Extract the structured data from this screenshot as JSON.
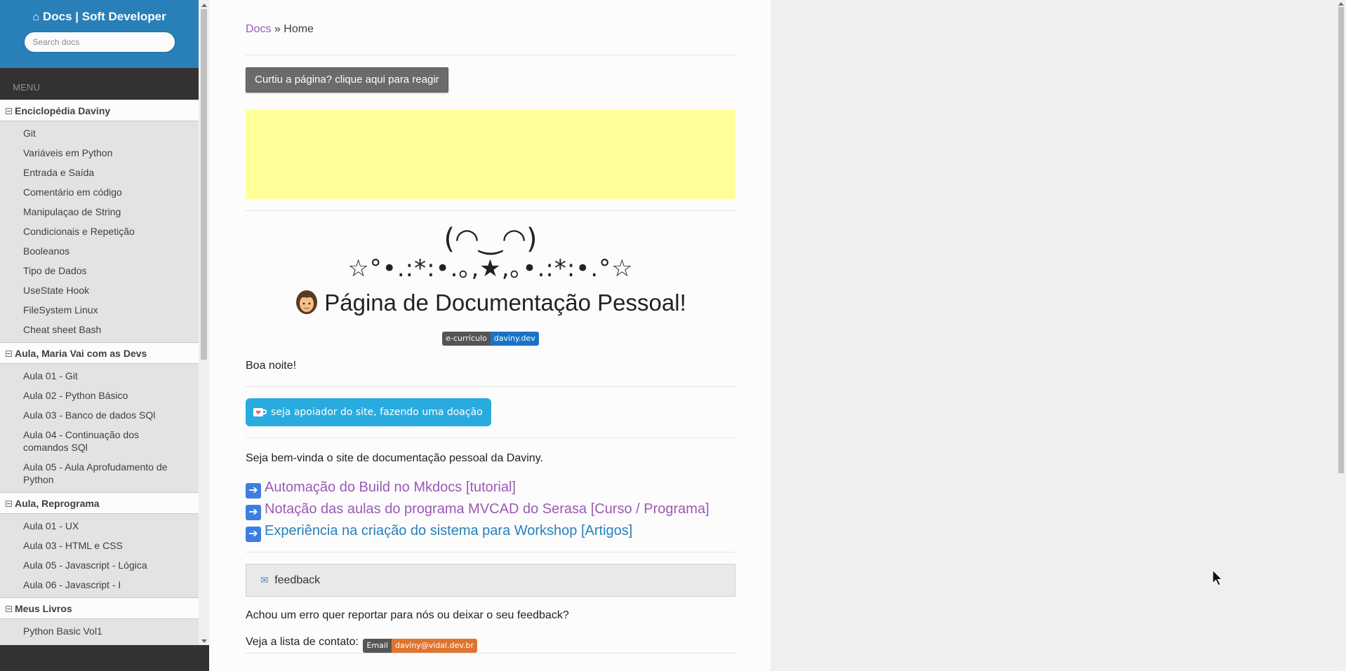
{
  "sidebar": {
    "brand": "Docs | Soft Developer",
    "search_placeholder": "Search docs",
    "menu_caption": "MENU",
    "sections": [
      {
        "title": "Enciclopédia Daviny",
        "items": [
          "Git",
          "Variáveis em Python",
          "Entrada e Saída",
          "Comentário em código",
          "Manipulaçao de String",
          "Condicionais e Repetição",
          "Booleanos",
          "Tipo de Dados",
          "UseState Hook",
          "FileSystem Linux",
          "Cheat sheet Bash"
        ]
      },
      {
        "title": "Aula, Maria Vai com as Devs",
        "items": [
          "Aula 01 - Git",
          "Aula 02 - Python Básico",
          "Aula 03 - Banco de dados SQl",
          "Aula 04 - Continuação dos comandos SQl",
          "Aula 05 - Aula Aprofudamento de Python"
        ]
      },
      {
        "title": "Aula, Reprograma",
        "items": [
          "Aula 01 - UX",
          "Aula 03 - HTML e CSS",
          "Aula 05 - Javascript - Lógica",
          "Aula 06 - Javascript - I"
        ]
      },
      {
        "title": "Meus Livros",
        "items": [
          "Python Basic Vol1"
        ]
      }
    ]
  },
  "breadcrumb": {
    "root": "Docs",
    "separator": "»",
    "current": "Home"
  },
  "react_button": "Curtiu a página? clique aqui para reagir",
  "kaomoji": {
    "line1": "(◠‿◠)",
    "line2": "☆°•.:*:•.｡,★,｡•.:*:•.°☆"
  },
  "page_title": "Página de Documentação Pessoal!",
  "badge_curriculo": {
    "left": "e-currículo",
    "right": "daviny.dev"
  },
  "greeting": "Boa noite!",
  "donate_button": "seja apoiador do site, fazendo uma doação",
  "welcome_text": "Seja bem-vinda o site de documentação pessoal da Daviny.",
  "links": [
    {
      "text": "Automação do Build no Mkdocs [tutorial]",
      "color": "#9b59b6"
    },
    {
      "text": "Notação das aulas do programa MVCAD do Serasa [Curso / Programa]",
      "color": "#9b59b6"
    },
    {
      "text": "Experiência na criação do sistema para Workshop [Artigos]",
      "color": "#2980b9"
    }
  ],
  "feedback_title": "feedback",
  "report_text": "Achou um erro quer reportar para nós ou deixar o seu feedback?",
  "contact_text": "Veja a lista de contato:",
  "badge_email": {
    "left": "Email",
    "right": "daviny@vidal.dev.br"
  },
  "colors": {
    "sidebar_top": "#2980b9",
    "sidebar_dark": "#343131",
    "link_purple": "#9b59b6",
    "link_blue": "#2980b9",
    "ad_yellow": "#ffff99"
  }
}
